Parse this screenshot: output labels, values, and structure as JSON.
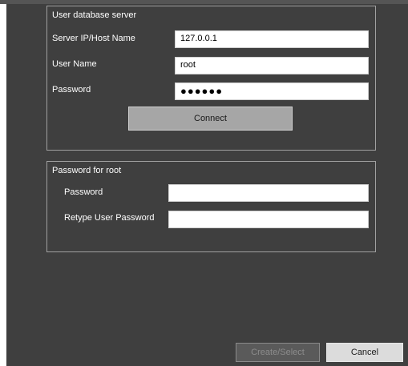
{
  "db_server": {
    "title": "User database server",
    "host_label": "Server IP/Host Name",
    "host_value": "127.0.0.1",
    "user_label": "User Name",
    "user_value": "root",
    "password_label": "Password",
    "password_value": "●●●●●●",
    "connect_label": "Connect"
  },
  "root_password": {
    "title": "Password for root",
    "password_label": "Password",
    "password_value": "",
    "retype_label": "Retype User Password",
    "retype_value": ""
  },
  "footer": {
    "create_label": "Create/Select",
    "cancel_label": "Cancel"
  }
}
